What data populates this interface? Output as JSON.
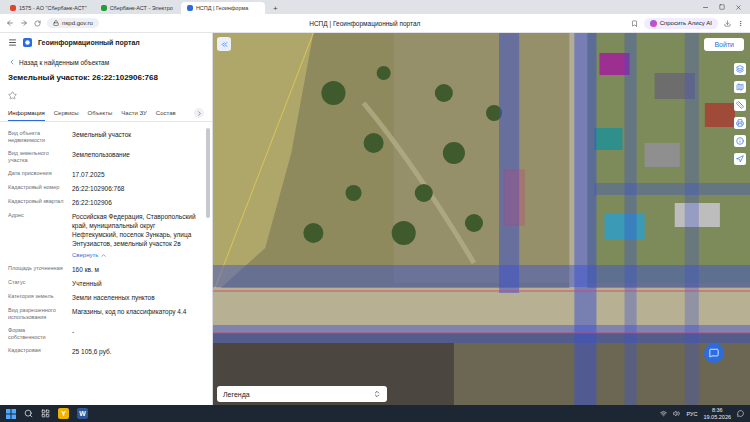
{
  "browser": {
    "tabs": [
      {
        "label": "1575 - АО \"Сбербанк-АСТ\"",
        "selected": false,
        "color": "#e0452b"
      },
      {
        "label": "Сбербанк-АСТ - Электро",
        "selected": false,
        "color": "#21a038"
      },
      {
        "label": "НСПД | Геоинформа",
        "selected": true,
        "color": "#2d6cdf"
      }
    ],
    "new_tab": "+",
    "address": "nspd.gov.ru",
    "page_title": "НСПД | Геоинформационный портал",
    "alice": "Спросить Алису AI"
  },
  "portal": {
    "title": "Геоинформационный портал",
    "back": "Назад к найденным объектам",
    "object_title": "Земельный участок: 26:22:102906:768",
    "favorite": false,
    "tabs": [
      {
        "label": "Информация",
        "selected": true
      },
      {
        "label": "Сервисы",
        "selected": false
      },
      {
        "label": "Объекты",
        "selected": false
      },
      {
        "label": "Части ЗУ",
        "selected": false
      },
      {
        "label": "Состав",
        "selected": false
      }
    ],
    "properties": [
      {
        "label": "Вид объекта недвижимости",
        "value": "Земельный участок"
      },
      {
        "label": "Вид земельного участка",
        "value": "Землепользование"
      },
      {
        "label": "Дата присвоения",
        "value": "17.07.2025"
      },
      {
        "label": "Кадастровый номер",
        "value": "26:22:102906:768"
      },
      {
        "label": "Кадастровый квартал",
        "value": "26:22:102906"
      },
      {
        "label": "Адрес",
        "value": "Российская Федерация, Ставропольский край, муниципальный округ Нефтекумский, поселок Зункарь, улица Энтузиастов, земельный участок 2в",
        "action": "Свернуть"
      },
      {
        "label": "Площадь уточненная",
        "value": "160 кв. м"
      },
      {
        "label": "Статус",
        "value": "Учтенный"
      },
      {
        "label": "Категория земель",
        "value": "Земли населенных пунктов"
      },
      {
        "label": "Вид разрешенного использования",
        "value": "Магазины, код по классификатору 4.4"
      },
      {
        "label": "Форма собственности",
        "value": "-"
      },
      {
        "label": "Кадастровая",
        "value": "25 105,6 руб."
      }
    ]
  },
  "map": {
    "login": "Войти",
    "legend": "Легенда"
  },
  "taskbar": {
    "apps": [
      {
        "label": "Y",
        "color": "#f0b400"
      },
      {
        "label": "W",
        "color": "#2b5797"
      }
    ],
    "language": "РУС",
    "time": "8:36",
    "date": "19.05.2026"
  }
}
